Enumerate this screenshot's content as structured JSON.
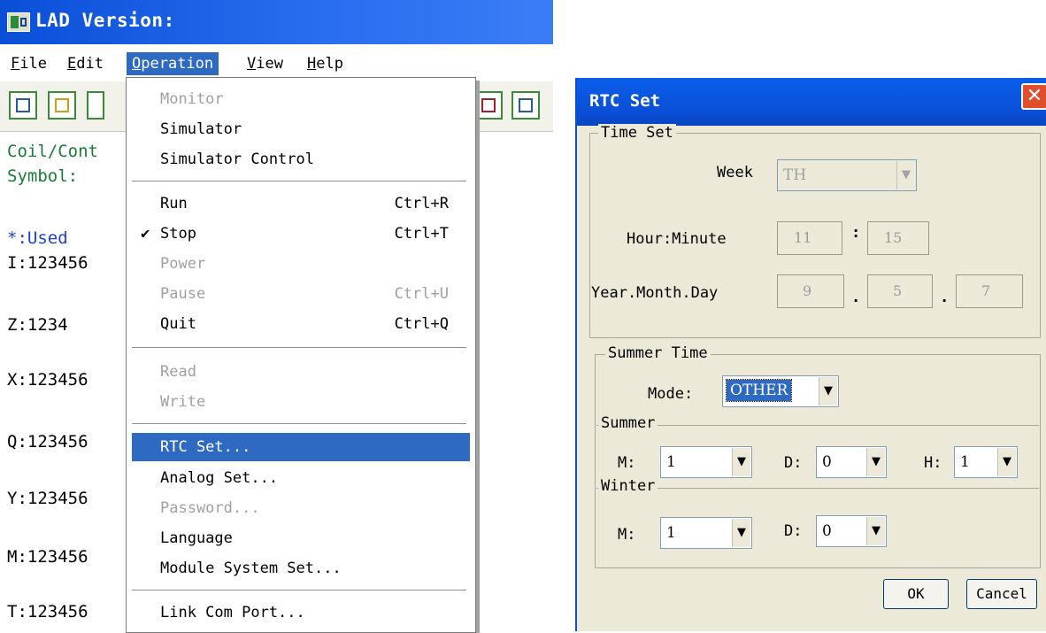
{
  "lad": {
    "title": "LAD Version:",
    "menubar": [
      {
        "pre": "",
        "u": "F",
        "post": "ile"
      },
      {
        "pre": "",
        "u": "E",
        "post": "dit"
      },
      {
        "pre": "",
        "u": "O",
        "post": "peration"
      },
      {
        "pre": "",
        "u": "V",
        "post": "iew"
      },
      {
        "pre": "",
        "u": "H",
        "post": "elp"
      }
    ],
    "side": {
      "coil": "Coil/Cont",
      "symbol": "Symbol:",
      "used": "*:Used",
      "rows": [
        "I:123456",
        "Z:1234",
        "X:123456",
        "Q:123456",
        "Y:123456",
        "M:123456",
        "T:123456"
      ]
    },
    "operation_menu": {
      "monitor": {
        "label": "Monitor",
        "shortcut": ""
      },
      "simulator": {
        "label": "Simulator",
        "shortcut": ""
      },
      "simulator_control": {
        "label": "Simulator Control",
        "shortcut": ""
      },
      "run": {
        "label": "Run",
        "shortcut": "Ctrl+R"
      },
      "stop": {
        "label": "Stop",
        "shortcut": "Ctrl+T",
        "check": "✔"
      },
      "power": {
        "label": "Power",
        "shortcut": ""
      },
      "pause": {
        "label": "Pause",
        "shortcut": "Ctrl+U"
      },
      "quit": {
        "label": "Quit",
        "shortcut": "Ctrl+Q"
      },
      "read": {
        "label": "Read",
        "shortcut": ""
      },
      "write": {
        "label": "Write",
        "shortcut": ""
      },
      "rtc_set": {
        "label": "RTC Set...",
        "shortcut": ""
      },
      "analog_set": {
        "label": "Analog Set...",
        "shortcut": ""
      },
      "password": {
        "label": "Password...",
        "shortcut": ""
      },
      "language": {
        "label": "Language",
        "shortcut": ""
      },
      "module_system_set": {
        "label": "Module System Set...",
        "shortcut": ""
      },
      "link_com_port": {
        "label": "Link Com Port...",
        "shortcut": ""
      }
    }
  },
  "rtc": {
    "title": "RTC Set",
    "close": "✕",
    "time_set": {
      "group": "Time Set",
      "week_label": "Week",
      "week_value": "TH",
      "hm_label": "Hour:Minute",
      "hour": "11",
      "colon": ":",
      "minute": "15",
      "ymd_label": "Year.Month.Day",
      "year": "9",
      "dot": ".",
      "month": "5",
      "day": "7"
    },
    "summer_time": {
      "group": "Summer Time",
      "mode_label": "Mode:",
      "mode_value": "OTHER",
      "summer_group": "Summer",
      "summer": {
        "m_label": "M:",
        "m": "1",
        "d_label": "D:",
        "d": "0",
        "h_label": "H:",
        "h": "1"
      },
      "winter_group": "Winter",
      "winter": {
        "m_label": "M:",
        "m": "1",
        "d_label": "D:",
        "d": "0"
      }
    },
    "ok": "OK",
    "cancel": "Cancel"
  },
  "colors": {
    "titlebar": "#0a4fd8",
    "menu_highlight": "#2f6ac2",
    "dialog_bg": "#ece9d8",
    "disabled_text": "#a0a0a0",
    "symbol_green": "#1a7a3a",
    "used_blue": "#1f3fd8"
  }
}
